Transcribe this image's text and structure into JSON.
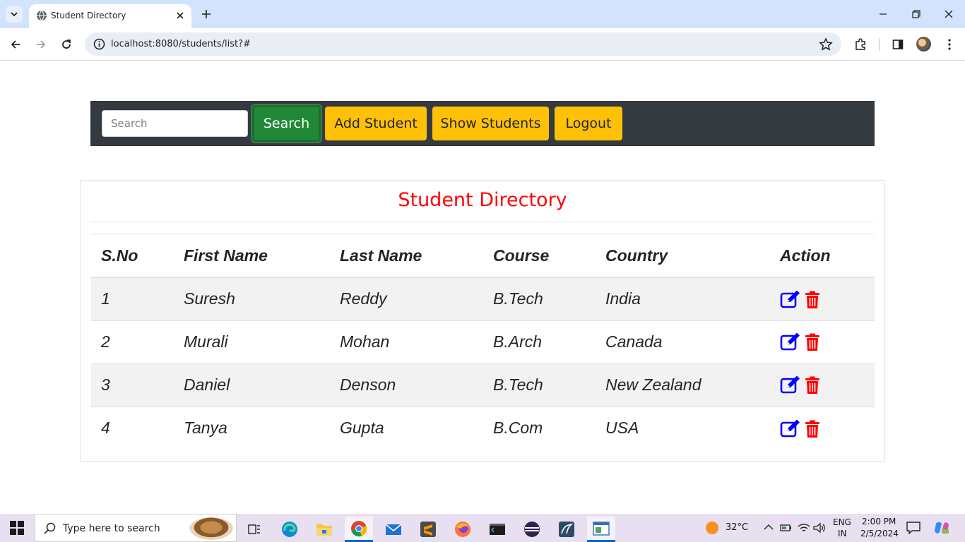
{
  "browser": {
    "tab_title": "Student Directory",
    "url": "localhost:8080/students/list?#"
  },
  "navbar": {
    "search_placeholder": "Search",
    "search_button": "Search",
    "add_student_button": "Add Student",
    "show_students_button": "Show Students",
    "logout_button": "Logout"
  },
  "card": {
    "title": "Student Directory"
  },
  "table": {
    "headers": [
      "S.No",
      "First Name",
      "Last Name",
      "Course",
      "Country",
      "Action"
    ],
    "rows": [
      {
        "sno": "1",
        "first": "Suresh",
        "last": "Reddy",
        "course": "B.Tech",
        "country": "India"
      },
      {
        "sno": "2",
        "first": "Murali",
        "last": "Mohan",
        "course": "B.Arch",
        "country": "Canada"
      },
      {
        "sno": "3",
        "first": "Daniel",
        "last": "Denson",
        "course": "B.Tech",
        "country": "New Zealand"
      },
      {
        "sno": "4",
        "first": "Tanya",
        "last": "Gupta",
        "course": "B.Com",
        "country": "USA"
      }
    ],
    "edit_icon": "edit-icon",
    "delete_icon": "trash-icon"
  },
  "taskbar": {
    "search_placeholder": "Type here to search",
    "weather": "32°C",
    "lang_line1": "ENG",
    "lang_line2": "IN",
    "time": "2:00 PM",
    "date": "2/5/2024"
  },
  "colors": {
    "title_red": "#ff0000",
    "navbar_dark": "#343a40",
    "button_warning": "#ffc107",
    "button_success": "#218838",
    "edit_blue": "#0000ff",
    "delete_red": "#ff0000"
  }
}
